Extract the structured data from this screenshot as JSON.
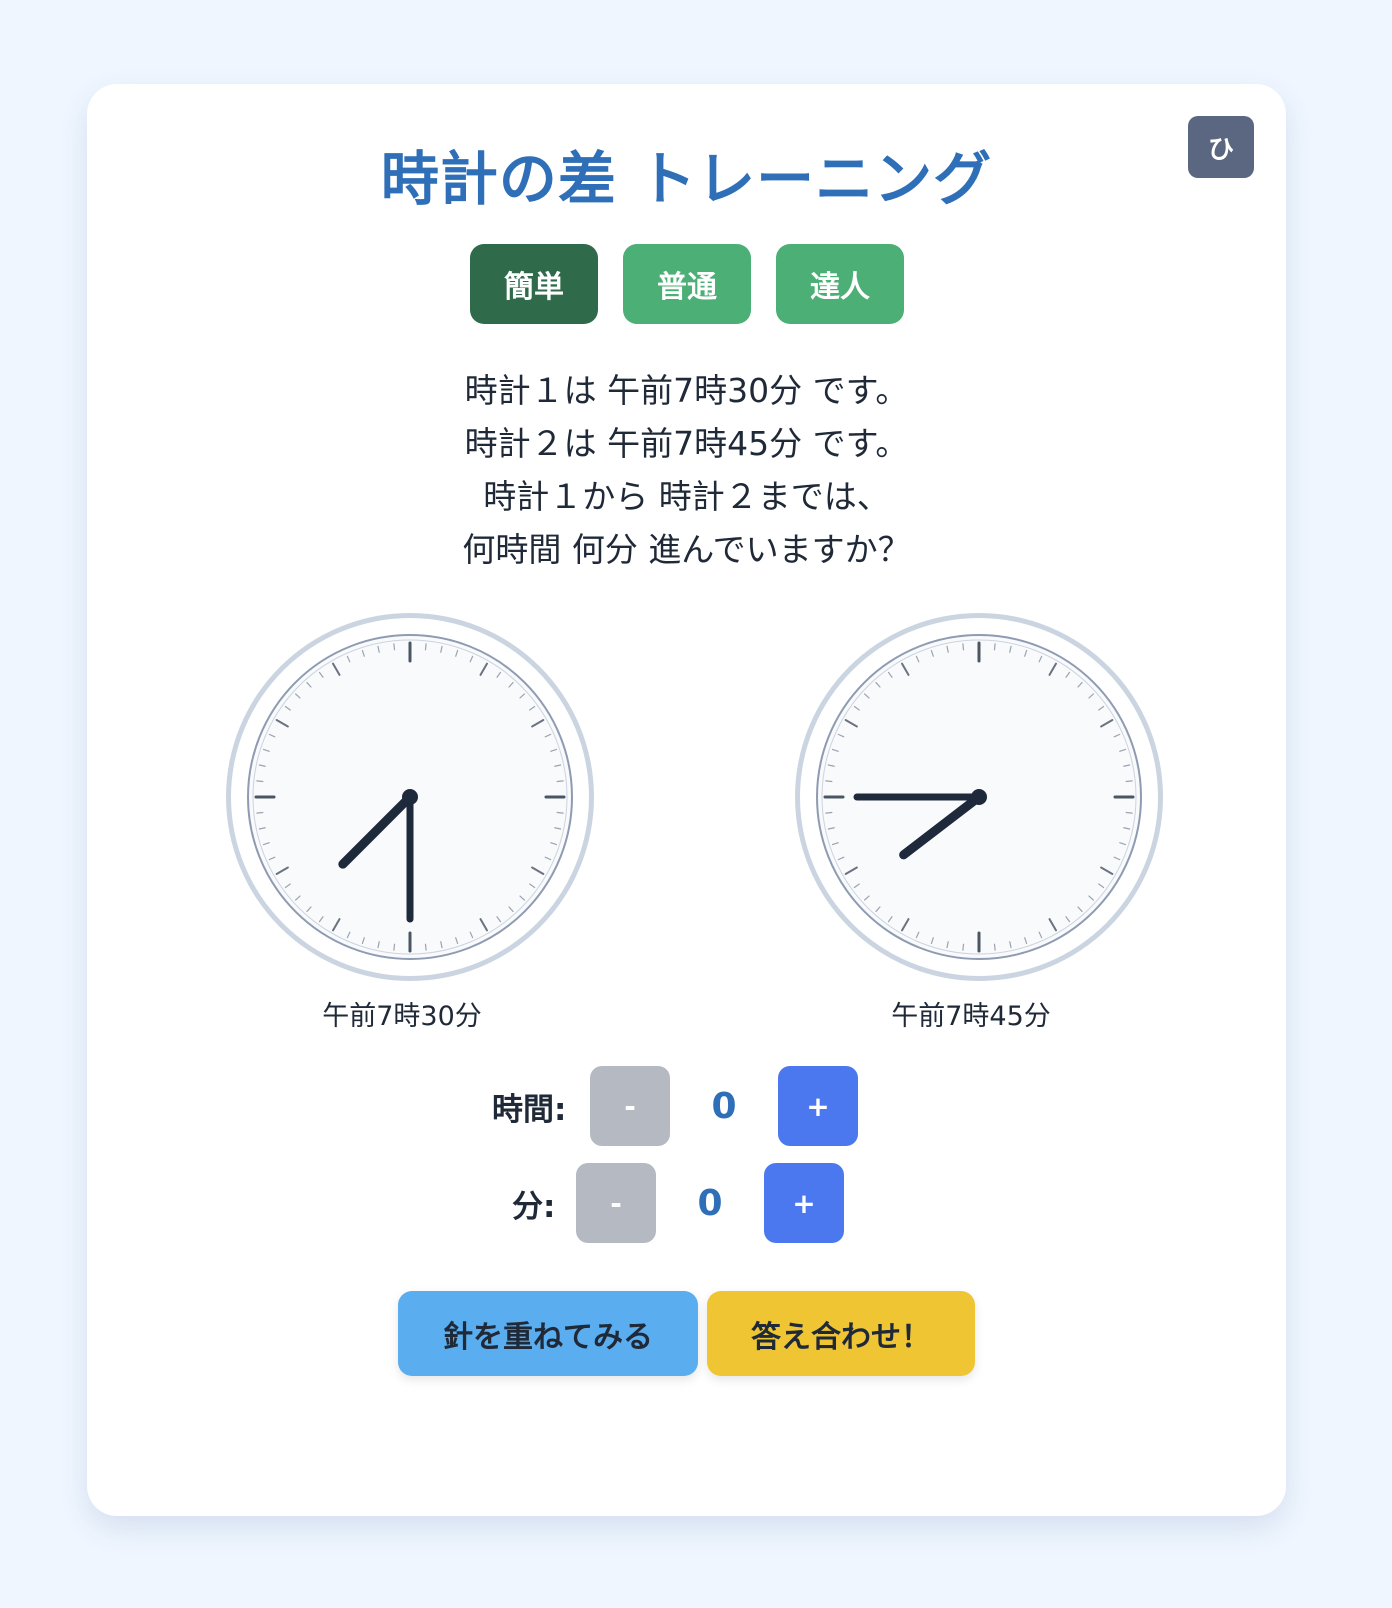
{
  "header": {
    "title": "時計の差 トレーニング",
    "kana_toggle_label": "ひ"
  },
  "levels": [
    {
      "label": "簡単",
      "active": true
    },
    {
      "label": "普通",
      "active": false
    },
    {
      "label": "達人",
      "active": false
    }
  ],
  "question": {
    "lines": [
      "時計１は 午前7時30分 です。",
      "時計２は 午前7時45分 です。",
      "時計１から 時計２までは、",
      "何時間 何分 進んでいますか？"
    ]
  },
  "clocks": [
    {
      "caption": "午前7時30分",
      "hour": 7,
      "minute": 30
    },
    {
      "caption": "午前7時45分",
      "hour": 7,
      "minute": 45
    }
  ],
  "answer": {
    "hours": {
      "label": "時間:",
      "value": "0",
      "minus_label": "-",
      "plus_label": "+"
    },
    "minutes": {
      "label": "分:",
      "value": "0",
      "minus_label": "-",
      "plus_label": "+"
    }
  },
  "actions": {
    "overlay_label": "針を重ねてみる",
    "check_label": "答え合わせ！"
  },
  "colors": {
    "title": "#2f6fb8",
    "level_active": "#2f6b4b",
    "level": "#4caf76",
    "minus": "#b4b9c2",
    "plus": "#4b78ee",
    "overlay_button": "#5aaeef",
    "check_button": "#efc534"
  }
}
